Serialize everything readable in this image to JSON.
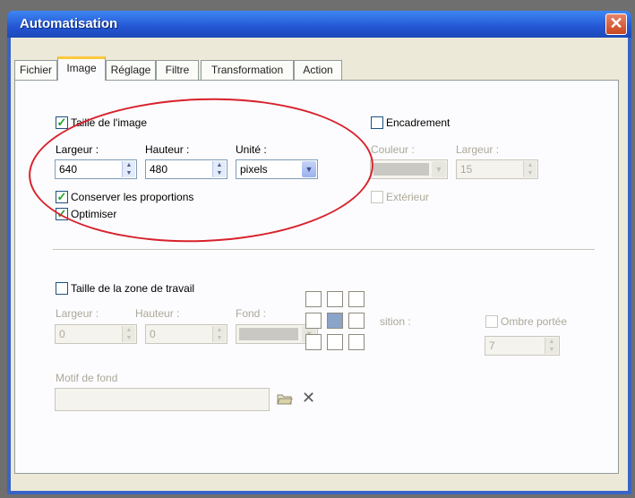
{
  "window": {
    "title": "Automatisation",
    "close_label": "✕"
  },
  "tabs": [
    "Fichier",
    "Image",
    "Réglage",
    "Filtre",
    "Transformation",
    "Action"
  ],
  "image_size": {
    "checkbox_label": "Taille de l'image",
    "checked": true,
    "width_label": "Largeur :",
    "width_value": "640",
    "height_label": "Hauteur :",
    "height_value": "480",
    "unit_label": "Unité :",
    "unit_value": "pixels",
    "keep_ratio_label": "Conserver les proportions",
    "keep_ratio_checked": true,
    "optimize_label": "Optimiser",
    "optimize_checked": true
  },
  "frame": {
    "checkbox_label": "Encadrement",
    "checked": false,
    "color_label": "Couleur :",
    "width_label": "Largeur :",
    "width_value": "15",
    "outside_label": "Extérieur"
  },
  "workspace": {
    "checkbox_label": "Taille de la zone de travail",
    "checked": false,
    "width_label": "Largeur :",
    "width_value": "0",
    "height_label": "Hauteur :",
    "height_value": "0",
    "background_label": "Fond :",
    "position_label": "sition :",
    "shadow_label": "Ombre portée",
    "shadow_value": "7",
    "pattern_label": "Motif de fond"
  },
  "icons": {
    "check": "✓",
    "folder": "folder-browse-icon",
    "delete": "✕",
    "spin_up": "▲",
    "spin_down": "▼",
    "dropdown": "▼"
  }
}
